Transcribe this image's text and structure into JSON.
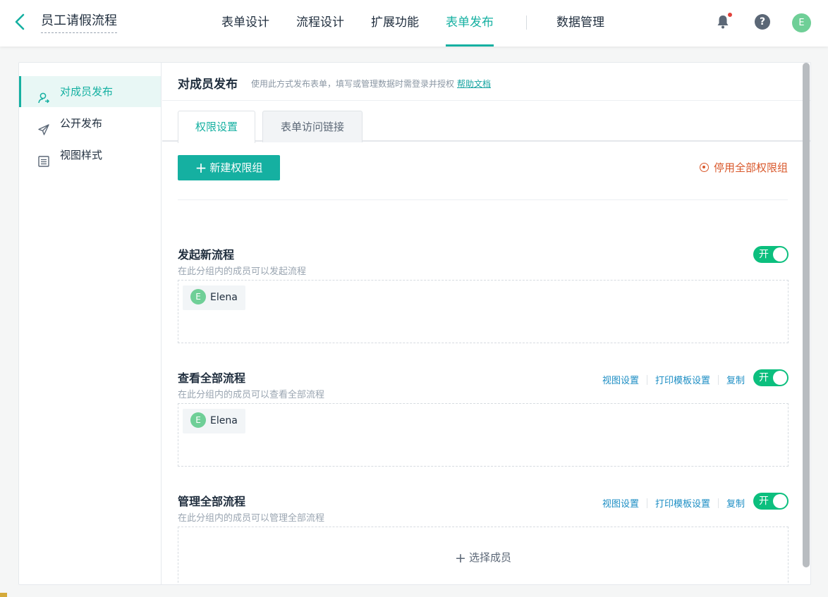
{
  "header": {
    "app_title": "员工请假流程",
    "nav": [
      {
        "label": "表单设计",
        "active": false
      },
      {
        "label": "流程设计",
        "active": false
      },
      {
        "label": "扩展功能",
        "active": false
      },
      {
        "label": "表单发布",
        "active": true
      },
      {
        "label": "数据管理",
        "active": false
      }
    ],
    "help_glyph": "?",
    "user_initial": "E",
    "icons": [
      "back-arrow-icon",
      "bell-icon",
      "help-icon"
    ]
  },
  "sidebar": {
    "items": [
      {
        "label": "对成员发布",
        "icon": "member-publish-icon",
        "active": true
      },
      {
        "label": "公开发布",
        "icon": "paper-plane-icon",
        "active": false
      },
      {
        "label": "视图样式",
        "icon": "list-view-icon",
        "active": false
      }
    ]
  },
  "main": {
    "title": "对成员发布",
    "description": "使用此方式发布表单，填写或管理数据时需登录并授权",
    "help_link": "帮助文档",
    "tabs": [
      {
        "label": "权限设置",
        "active": true
      },
      {
        "label": "表单访问链接",
        "active": false
      }
    ],
    "new_group_button": "新建权限组",
    "disable_all": "停用全部权限组",
    "groups": [
      {
        "title": "发起新流程",
        "desc": "在此分组内的成员可以发起流程",
        "toggle_label": "开",
        "enabled": true,
        "members": [
          {
            "initial": "E",
            "name": "Elena"
          }
        ]
      },
      {
        "title": "查看全部流程",
        "desc": "在此分组内的成员可以查看全部流程",
        "actions": [
          "视图设置",
          "打印模板设置",
          "复制"
        ],
        "toggle_label": "开",
        "enabled": true,
        "members": [
          {
            "initial": "E",
            "name": "Elena"
          }
        ]
      },
      {
        "title": "管理全部流程",
        "desc": "在此分组内的成员可以管理全部流程",
        "actions": [
          "视图设置",
          "打印模板设置",
          "复制"
        ],
        "toggle_label": "开",
        "enabled": true,
        "select_members": "选择成员"
      }
    ]
  },
  "colors": {
    "accent": "#15b0a1",
    "toggle_on": "#0cbf7e",
    "warning": "#d9582b",
    "link": "#1d8ec4",
    "avatar": "#6fcf97"
  }
}
